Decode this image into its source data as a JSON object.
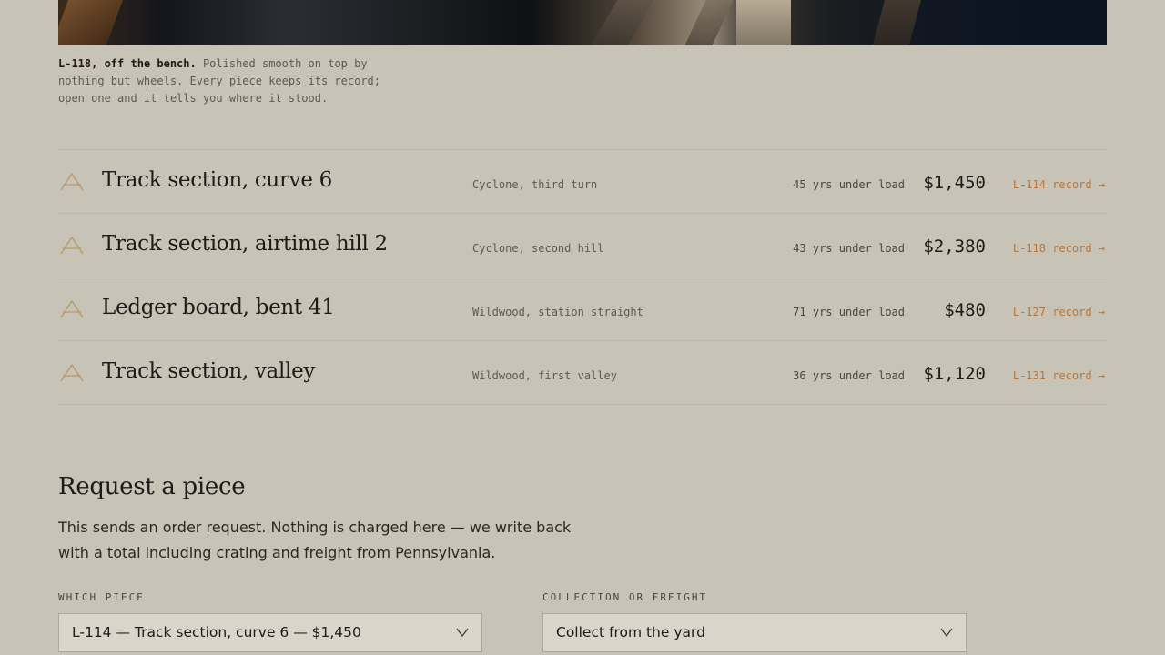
{
  "caption": {
    "bold": "L-118, off the bench.",
    "text": "Polished smooth on top by nothing but wheels. Every piece keeps its record; open one and it tells you where it stood."
  },
  "pieces": [
    {
      "name": "Track section, curve 6",
      "where": "Cyclone, third turn",
      "years": "45 yrs under load",
      "price": "$1,450",
      "record": "L-114 record →"
    },
    {
      "name": "Track section, airtime hill 2",
      "where": "Cyclone, second hill",
      "years": "43 yrs under load",
      "price": "$2,380",
      "record": "L-118 record →"
    },
    {
      "name": "Ledger board, bent 41",
      "where": "Wildwood, station straight",
      "years": "71 yrs under load",
      "price": "$480",
      "record": "L-127 record →"
    },
    {
      "name": "Track section, valley",
      "where": "Wildwood, first valley",
      "years": "36 yrs under load",
      "price": "$1,120",
      "record": "L-131 record →"
    }
  ],
  "request": {
    "title": "Request a piece",
    "text": "This sends an order request. Nothing is charged here — we write back with a total including crating and freight from Pennsylvania.",
    "piece_label": "WHICH PIECE",
    "piece_value": "L-114 — Track section, curve 6 — $1,450",
    "delivery_label": "COLLECTION OR FREIGHT",
    "delivery_value": "Collect from the yard"
  },
  "colors": {
    "background": "#c8c3b7",
    "accent": "#b8773a",
    "text": "#1d1b17"
  }
}
